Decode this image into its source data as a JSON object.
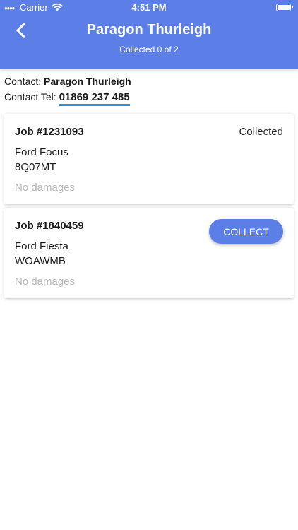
{
  "status_bar": {
    "signal": "••••",
    "carrier": "Carrier",
    "time": "4:51 PM"
  },
  "header": {
    "title": "Paragon Thurleigh",
    "subtitle": "Collected 0 of 2",
    "color": "#5b7fe6"
  },
  "contact": {
    "name_label": "Contact:",
    "name": "Paragon Thurleigh",
    "tel_label": "Contact Tel:",
    "tel": "01869 237 485",
    "link_color": "#2c8fe0"
  },
  "jobs": [
    {
      "number": "Job #1231093",
      "status": "Collected",
      "model": "Ford Focus",
      "registration": "8Q07MT",
      "damages": "No damages"
    },
    {
      "number": "Job #1840459",
      "action_label": "COLLECT",
      "model": "Ford Fiesta",
      "registration": "WOAWMB",
      "damages": "No damages"
    }
  ]
}
